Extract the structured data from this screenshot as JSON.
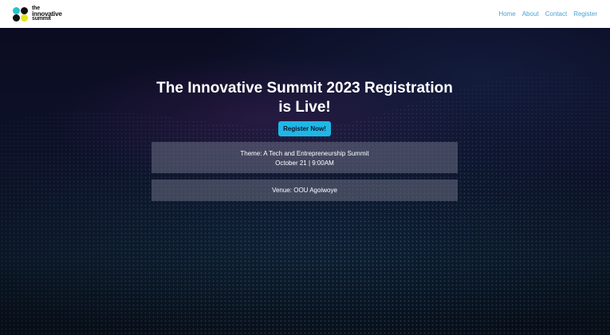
{
  "brand": {
    "lines": [
      "the",
      "innovative",
      "summit"
    ],
    "colors": {
      "teal": "#27c3c9",
      "dark": "#111111",
      "yellow": "#e5e51a"
    }
  },
  "nav": {
    "links": [
      "Home",
      "About",
      "Contact",
      "Register"
    ],
    "link_color": "#4aa3d6"
  },
  "hero": {
    "title": "The Innovative Summit 2023 Registration is Live!",
    "button_label": "Register Now!",
    "button_color": "#1fb7e6",
    "theme": "Theme: A Tech and Entrepreneurship Summit",
    "date": "October 21 | 9:00AM",
    "venue": "Venue: OOU Agoiwoye"
  }
}
